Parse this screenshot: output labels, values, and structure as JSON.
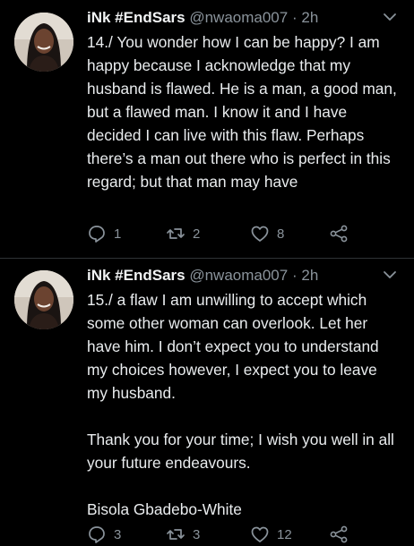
{
  "tweets": [
    {
      "display_name": "iNk #EndSars",
      "handle": "@nwaoma007",
      "separator": "·",
      "time": "2h",
      "text": "14./ You wonder how I can be happy? I am happy because I acknowledge that my husband is flawed. He is a man, a good man, but a flawed man. I know it and I have decided I can live with this flaw. Perhaps there’s a man out there who is perfect in this regard; but that man may have",
      "replies": "1",
      "retweets": "2",
      "likes": "8"
    },
    {
      "display_name": "iNk #EndSars",
      "handle": "@nwaoma007",
      "separator": "·",
      "time": "2h",
      "paragraphs": [
        "15./ a flaw I am unwilling to accept which some other woman can overlook. Let her have him. I don’t expect you to understand my choices however, I expect you to leave my husband.",
        "Thank you for your time; I wish you well in all your future endeavours.",
        "Bisola Gbadebo-White"
      ],
      "replies": "3",
      "retweets": "3",
      "likes": "12"
    }
  ],
  "icons": {
    "reply": "reply-icon",
    "retweet": "retweet-icon",
    "like": "heart-icon",
    "share": "share-icon",
    "menu": "chevron-down-icon"
  },
  "colors": {
    "background": "#000000",
    "text": "#e9ecee",
    "secondary": "#8a939b"
  }
}
